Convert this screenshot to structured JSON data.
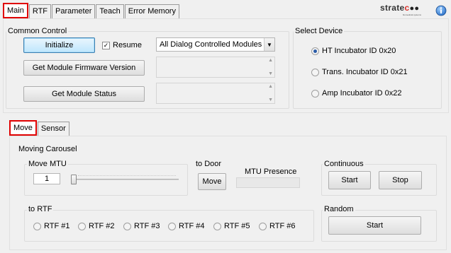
{
  "tabs": [
    "Main",
    "RTF",
    "Parameter",
    "Teach",
    "Error Memory"
  ],
  "logo": {
    "text_a": "strate",
    "text_b": "c",
    "sub": "biomedical systems"
  },
  "info_icon": "info-icon",
  "common": {
    "title": "Common Control",
    "initialize": "Initialize",
    "resume_label": "Resume",
    "resume_checked": true,
    "module_select": "All Dialog Controlled Modules",
    "firmware_btn": "Get Module Firmware Version",
    "status_btn": "Get Module Status"
  },
  "device": {
    "title": "Select Device",
    "options": [
      "HT Incubator ID 0x20",
      "Trans. Incubator ID 0x21",
      "Amp Incubator ID 0x22"
    ],
    "selected_index": 0
  },
  "subtabs": [
    "Move",
    "Sensor"
  ],
  "moving": {
    "title": "Moving Carousel",
    "move_mtu": {
      "title": "Move MTU",
      "value": "1"
    },
    "to_door": {
      "title": "to Door",
      "move_btn": "Move",
      "mtu_presence": "MTU Presence"
    },
    "continuous": {
      "title": "Continuous",
      "start": "Start",
      "stop": "Stop"
    },
    "to_rtf": {
      "title": "to RTF",
      "options": [
        "RTF #1",
        "RTF #2",
        "RTF #3",
        "RTF #4",
        "RTF #5",
        "RTF #6"
      ]
    },
    "random": {
      "title": "Random",
      "start": "Start"
    }
  }
}
